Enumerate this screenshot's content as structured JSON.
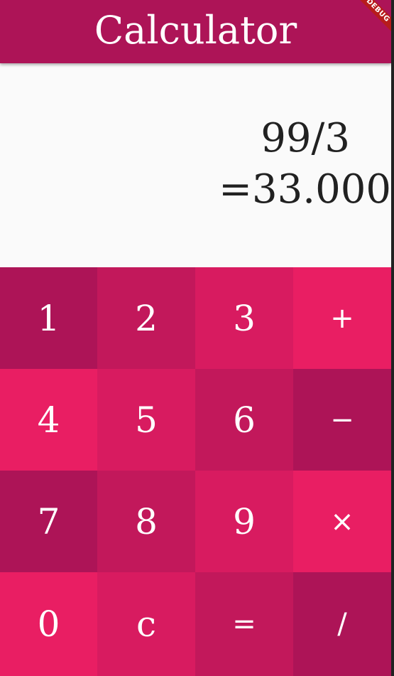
{
  "appbar": {
    "title": "Calculator",
    "background": "#ad1457"
  },
  "debug_banner": {
    "label": "DEBUG",
    "color": "#b71c1c"
  },
  "display": {
    "expression": "99/3",
    "result": "=33.000"
  },
  "keypad": {
    "colors": {
      "shade1": "#ad1457",
      "shade2": "#c2185b",
      "shade3": "#d81b60",
      "shade4": "#e91e63"
    },
    "keys": [
      {
        "label": "1"
      },
      {
        "label": "2"
      },
      {
        "label": "3"
      },
      {
        "label": "+"
      },
      {
        "label": "4"
      },
      {
        "label": "5"
      },
      {
        "label": "6"
      },
      {
        "label": "−"
      },
      {
        "label": "7"
      },
      {
        "label": "8"
      },
      {
        "label": "9"
      },
      {
        "label": "×"
      },
      {
        "label": "0"
      },
      {
        "label": "c"
      },
      {
        "label": "="
      },
      {
        "label": "/"
      }
    ]
  }
}
